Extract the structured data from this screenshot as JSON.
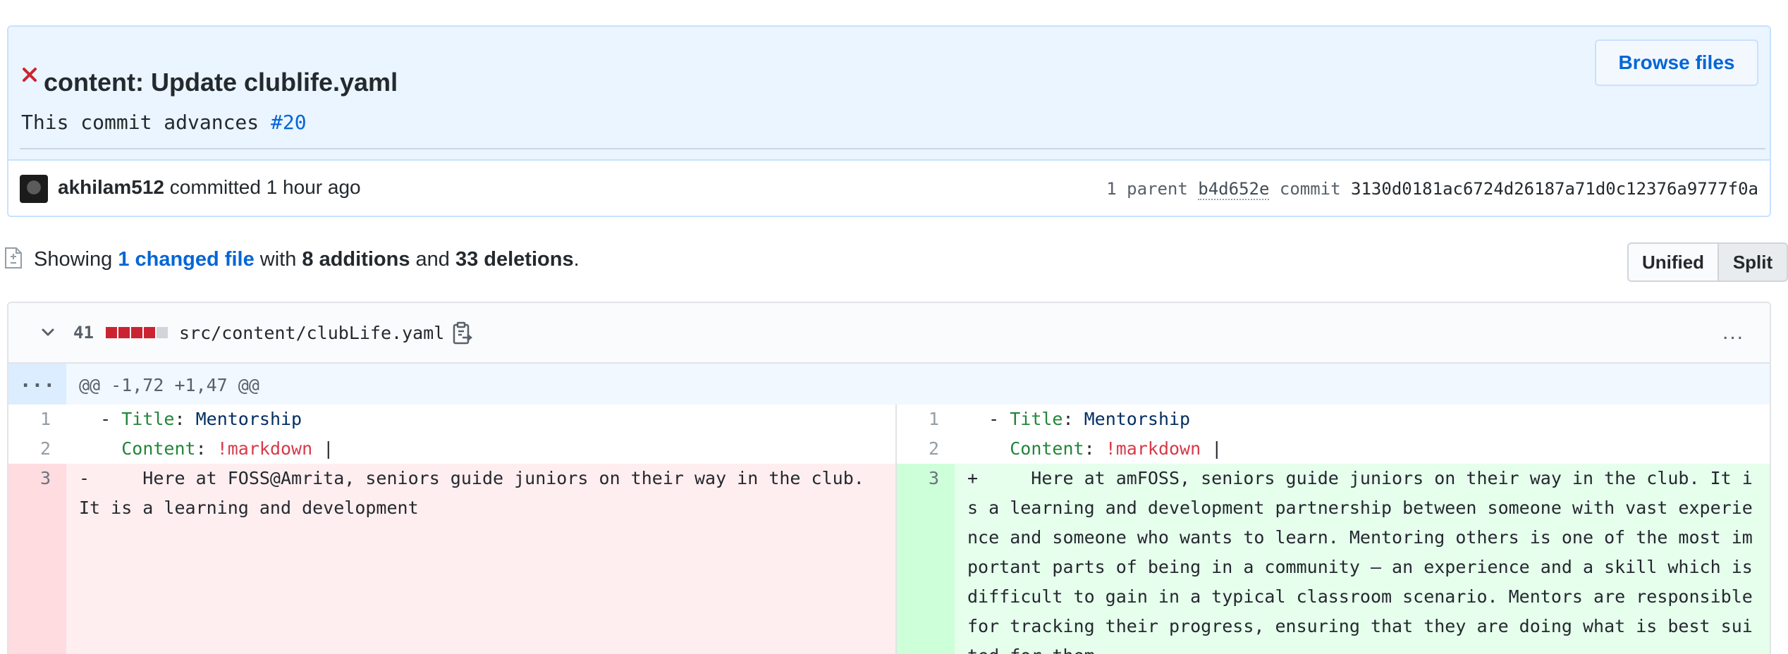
{
  "commit": {
    "title": "content: Update clublife.yaml",
    "desc_prefix": "This commit advances ",
    "issue_ref": "#20",
    "browse_label": "Browse files",
    "author": "akhilam512",
    "action": " committed 1 hour ago",
    "parent_label": "1 parent ",
    "parent_sha": "b4d652e",
    "commit_label": "commit ",
    "commit_sha": "3130d0181ac6724d26187a71d0c12376a9777f0a"
  },
  "toolbar": {
    "showing": "Showing ",
    "changed_files": "1 changed file",
    "with": " with ",
    "additions": "8 additions",
    "and": " and ",
    "deletions": "33 deletions",
    "period": ".",
    "unified_label": "Unified",
    "split_label": "Split"
  },
  "file": {
    "diffstat": "41",
    "diffstat_blocks": [
      "del",
      "del",
      "del",
      "del",
      "neutral"
    ],
    "path": "src/content/clubLife.yaml",
    "more_label": "...",
    "hunk_expand": "...",
    "hunk_header": "@@ -1,72 +1,47 @@"
  },
  "diff": {
    "left": [
      {
        "num": "1",
        "type": "context",
        "marker": "",
        "indent": "  ",
        "dash": "- ",
        "key": "Title",
        "sep": ": ",
        "value": "Mentorship"
      },
      {
        "num": "2",
        "type": "context",
        "marker": "",
        "indent": "    ",
        "dash": "",
        "key": "Content",
        "sep": ": ",
        "tag": "!markdown",
        "pipe": " |"
      },
      {
        "num": "3",
        "type": "del",
        "text": "-     Here at FOSS@Amrita, seniors guide juniors on their way in the club. It is a learning and development"
      }
    ],
    "right": [
      {
        "num": "1",
        "type": "context",
        "indent": "  ",
        "dash": "- ",
        "key": "Title",
        "sep": ": ",
        "value": "Mentorship"
      },
      {
        "num": "2",
        "type": "context",
        "indent": "    ",
        "dash": "",
        "key": "Content",
        "sep": ": ",
        "tag": "!markdown",
        "pipe": " |"
      },
      {
        "num": "3",
        "type": "add",
        "text": "+     Here at amFOSS, seniors guide juniors on their way in the club. It is a learning and development partnership between someone with vast experience and someone who wants to learn. Mentoring others is one of the most important parts of being in a community — an experience and a skill which is difficult to gain in a typical classroom scenario. Mentors are responsible for tracking their progress, ensuring that they are doing what is best suited for them."
      }
    ]
  },
  "colors": {
    "accent": "#0366d6",
    "error": "#cb2431",
    "del_bg": "#ffeef0",
    "add_bg": "#e6ffed"
  },
  "icons": {
    "status": "x-icon",
    "file": "file-diff-icon",
    "collapse": "chevron-down-icon",
    "copy": "clipboard-icon",
    "more": "kebab-horizontal-icon"
  }
}
